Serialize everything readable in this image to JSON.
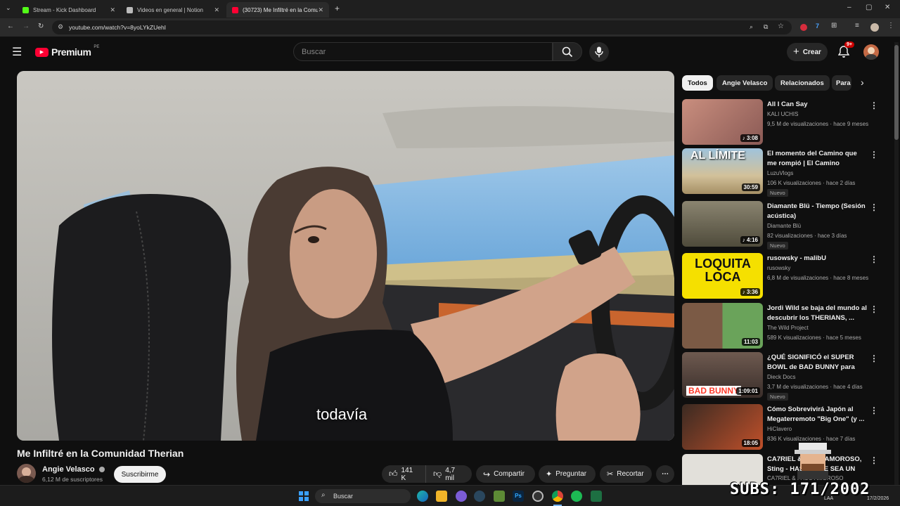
{
  "browser": {
    "tabs": [
      {
        "title": "Stream - Kick Dashboard",
        "favicon_color": "#53fc18"
      },
      {
        "title": "Videos en general | Notion",
        "favicon_color": "#bbbbbb"
      },
      {
        "title": "(30723) Me Infiltré en la Comun",
        "favicon_color": "#ff0033",
        "active": true
      }
    ],
    "new_tab_label": "+",
    "url": "youtube.com/watch?v=8yoLYkZUehI",
    "window_controls": [
      "–",
      "▢",
      "✕"
    ]
  },
  "youtube": {
    "logo_text": "Premium",
    "logo_region": "PE",
    "search_placeholder": "Buscar",
    "create_label": "Crear",
    "notif_badge": "9+"
  },
  "video": {
    "subtitle": "todavía",
    "title": "Me Infiltré en la Comunidad Therian",
    "channel": "Angie Velasco",
    "subscribers": "6,12 M de suscriptores",
    "subscribe_label": "Suscribirme",
    "likes": "141 K",
    "dislikes": "4,7 mil",
    "share_label": "Compartir",
    "ask_label": "Preguntar",
    "clip_label": "Recortar"
  },
  "sidebar": {
    "chips": [
      "Todos",
      "Angie Velasco",
      "Relacionados",
      "Para"
    ],
    "items": [
      {
        "title": "All I Can Say",
        "channel": "KALI UCHIS",
        "meta": "9,5 M de visualizaciones · hace 9 meses",
        "duration": "3:08",
        "badge": "",
        "thumb_color": "#b07a70"
      },
      {
        "title": "El momento del Camino que me rompió | El Camino",
        "channel": "LuzuVlogs",
        "meta": "106 K visualizaciones · hace 2 días",
        "duration": "30:59",
        "badge": "Nuevo",
        "thumb_color": "#9fb6c9",
        "thumb_text": "AL LÍMITE"
      },
      {
        "title": "Diamante Blü - Tiempo (Sesión acústica)",
        "channel": "Diamante Blü",
        "meta": "82 visualizaciones · hace 3 días",
        "duration": "4:16",
        "badge": "Nuevo",
        "thumb_color": "#6b6552"
      },
      {
        "title": "rusowsky - malibU",
        "channel": "rusowsky",
        "meta": "6,8 M de visualizaciones · hace 8 meses",
        "duration": "3:36",
        "badge": "",
        "thumb_color": "#f5e000",
        "thumb_text": "LOQUITA LOCA"
      },
      {
        "title": "Jordi Wild se baja del mundo al descubrir los THERIANS, ...",
        "channel": "The Wild Project",
        "meta": "589 K visualizaciones · hace 5 meses",
        "duration": "11:03",
        "badge": "",
        "thumb_color": "#7b5a45"
      },
      {
        "title": "¿QUÉ SIGNIFICÓ el SUPER BOWL de BAD BUNNY para los...",
        "channel": "Dieck Docs",
        "meta": "3,7 M de visualizaciones · hace 4 días",
        "duration": "1:09:01",
        "badge": "Nuevo",
        "thumb_color": "#5a4a45",
        "thumb_text": "BAD BUNNY"
      },
      {
        "title": "Cómo Sobrevivirá Japón al Megaterremoto \"Big One\" (y ...",
        "channel": "HiClavero",
        "meta": "836 K visualizaciones · hace 7 días",
        "duration": "18:05",
        "badge": "",
        "thumb_color": "#5a3a2a"
      },
      {
        "title": "CA7RIEL & PACO AMOROSO, Sting - HASTA QUE SEA UN MA...",
        "channel": "CA7RIEL & PACO AMOROSO",
        "meta": "",
        "duration": "",
        "badge": "",
        "thumb_color": "#d8d8d8"
      }
    ]
  },
  "taskbar": {
    "search_label": "Buscar",
    "lang": "LAA",
    "date": "17/2/2026"
  },
  "overlay": {
    "subs_text": "SUBS: 171/2002"
  }
}
